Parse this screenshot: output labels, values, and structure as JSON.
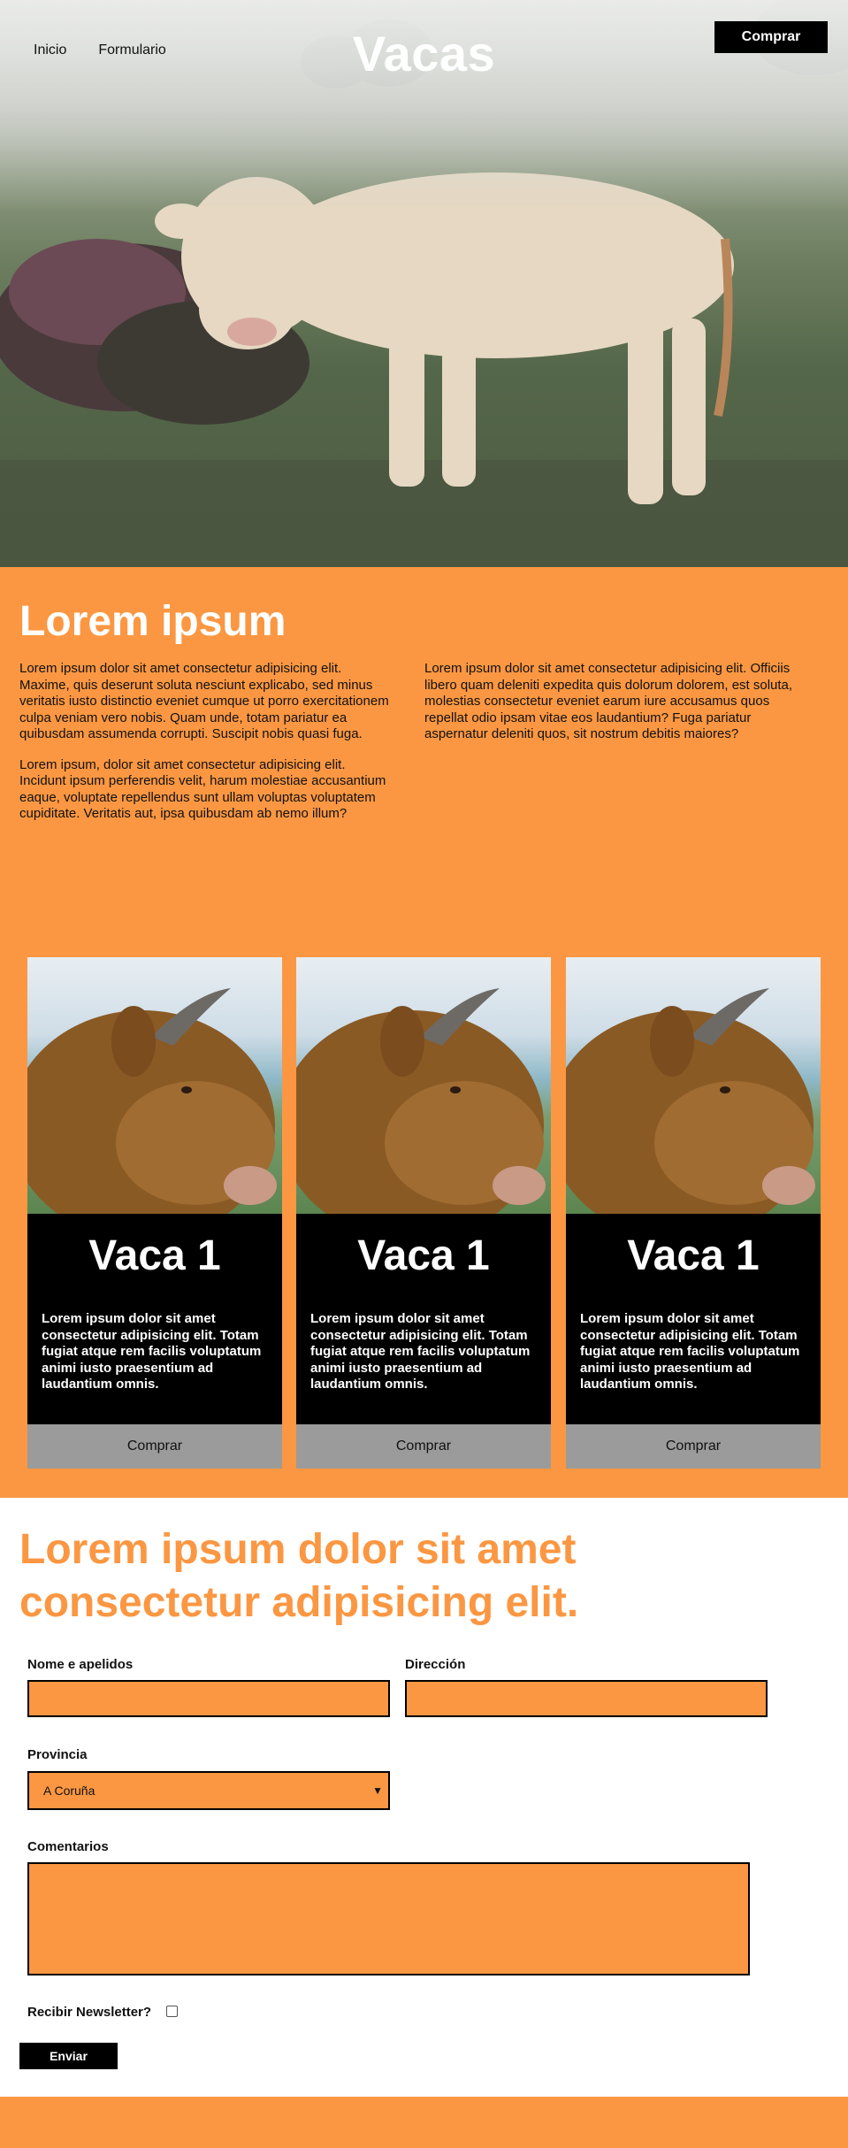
{
  "nav": {
    "links": [
      "Inicio",
      "Formulario"
    ]
  },
  "brand": "Vacas",
  "header_buy": "Comprar",
  "intro": {
    "title": "Lorem ipsum",
    "left_paragraphs": [
      "Lorem ipsum dolor sit amet consectetur adipisicing elit. Maxime, quis deserunt soluta nesciunt explicabo, sed minus veritatis iusto distinctio eveniet cumque ut porro exercitationem culpa veniam vero nobis. Quam unde, totam pariatur ea quibusdam assumenda corrupti. Suscipit nobis quasi fuga.",
      "Lorem ipsum, dolor sit amet consectetur adipisicing elit. Incidunt ipsum perferendis velit, harum molestiae accusantium eaque, voluptate repellendus sunt ullam voluptas voluptatem cupiditate. Veritatis aut, ipsa quibusdam ab nemo illum?"
    ],
    "right_paragraphs": [
      "Lorem ipsum dolor sit amet consectetur adipisicing elit. Officiis libero quam deleniti expedita quis dolorum dolorem, est soluta, molestias consectetur eveniet earum iure accusamus quos repellat odio ipsam vitae eos laudantium? Fuga pariatur aspernatur deleniti quos, sit nostrum debitis maiores?"
    ]
  },
  "cards": [
    {
      "title": "Vaca 1",
      "text": "Lorem ipsum dolor sit amet consectetur adipisicing elit. Totam fugiat atque rem facilis voluptatum animi iusto praesentium ad laudantium omnis.",
      "button": "Comprar"
    },
    {
      "title": "Vaca 1",
      "text": "Lorem ipsum dolor sit amet consectetur adipisicing elit. Totam fugiat atque rem facilis voluptatum animi iusto praesentium ad laudantium omnis.",
      "button": "Comprar"
    },
    {
      "title": "Vaca 1",
      "text": "Lorem ipsum dolor sit amet consectetur adipisicing elit. Totam fugiat atque rem facilis voluptatum animi iusto praesentium ad laudantium omnis.",
      "button": "Comprar"
    }
  ],
  "form": {
    "title": "Lorem ipsum dolor sit amet consectetur adipisicing elit.",
    "name_label": "Nome e apelidos",
    "address_label": "Dirección",
    "province_label": "Provincia",
    "province_value": "A Coruña",
    "comments_label": "Comentarios",
    "newsletter_label": "Recibir Newsletter?",
    "submit": "Enviar"
  },
  "colors": {
    "accent": "#fb9742",
    "dark": "#000000",
    "button_gray": "#9b9b9b"
  }
}
